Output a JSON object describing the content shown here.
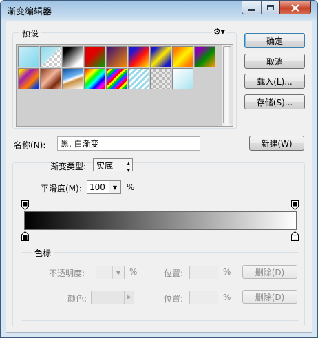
{
  "window": {
    "title": "渐变编辑器"
  },
  "presets": {
    "label": "预设",
    "gear_label": "⚙▾",
    "swatches": [
      {
        "name": "foreground-background",
        "bg": "linear-gradient(135deg,#c8eef8,#7fd6ec)"
      },
      {
        "name": "foreground-transparent",
        "bg": "linear-gradient(135deg,#8fd8ea 0%,#b9e8f2 50%,transparent 51%),repeating-conic-gradient(#ccc 0 25%,#fff 0 50%) 0 0/8px 8px"
      },
      {
        "name": "black-white",
        "bg": "linear-gradient(135deg,#000 20%,#fff 80%)"
      },
      {
        "name": "red-green",
        "bg": "linear-gradient(135deg,#e00000,#e00000 40%,#00a000)"
      },
      {
        "name": "violet-orange",
        "bg": "linear-gradient(135deg,#3a0e7a,#f58a00)"
      },
      {
        "name": "blue-red-yellow",
        "bg": "linear-gradient(135deg,#1e18d8 20%,#ff1010 55%,#ffe600)"
      },
      {
        "name": "blue-yellow-blue",
        "bg": "linear-gradient(135deg,#1818c8 15%,#ffe900 50%,#1818c8 85%)"
      },
      {
        "name": "orange-yellow-orange",
        "bg": "linear-gradient(135deg,#ff7a00 15%,#fff200 50%,#ff7a00 85%)"
      },
      {
        "name": "violet-green-orange",
        "bg": "linear-gradient(135deg,#8a00b0 20%,#008a00 55%,#ff9400)"
      },
      {
        "name": "yellow-violet-orange-blue",
        "bg": "linear-gradient(135deg,#ffd400 10%,#a020b0 35%,#ff7a00 65%,#1040d0 90%)"
      },
      {
        "name": "copper",
        "bg": "linear-gradient(135deg,#8b3a1a,#f2b49a 45%,#7a2c10 75%,#e8a080)"
      },
      {
        "name": "chrome",
        "bg": "linear-gradient(160deg,#0a50a0,#6ab0f0 40%,#fff 50%,#c89040 60%,#fff)"
      },
      {
        "name": "spectrum",
        "bg": "linear-gradient(135deg,#ff0000,#ff8800,#ffff00,#00ff00,#00ffff,#0000ff,#ff00ff,#ff0000)"
      },
      {
        "name": "transparent-rainbow",
        "bg": "repeating-linear-gradient(135deg,#ff0000 0 3px,#ffee00 3px 6px,#00d000 6px 9px,#0060ff 9px 12px,#c000ff 12px 15px)"
      },
      {
        "name": "transparent-stripes",
        "bg": "repeating-linear-gradient(135deg,#9ad8ec 0 3px,#ffffff 3px 6px),repeating-conic-gradient(#ccc 0 25%,#fff 0 50%) 0 0/8px 8px"
      },
      {
        "name": "checker-transparent",
        "bg": "repeating-conic-gradient(#b8b8b8 0 25%,#e8e8e8 0 50%) 0 0/8px 8px"
      },
      {
        "name": "white-cyan",
        "bg": "linear-gradient(135deg,#ffffff,#cfeff6 60%,#a8e2ef)"
      }
    ]
  },
  "buttons": {
    "ok": "确定",
    "cancel": "取消",
    "load": "载入(L)...",
    "save": "存储(S)...",
    "new": "新建(W)"
  },
  "name": {
    "label": "名称(N):",
    "value": "黑, 白渐变"
  },
  "gradient": {
    "type_label": "渐变类型:",
    "type_value": "实底",
    "smoothness_label": "平滑度(M):",
    "smoothness_value": "100",
    "smoothness_unit": "%",
    "start_color": "#000000",
    "end_color": "#ffffff"
  },
  "color_stops": {
    "label": "色标",
    "opacity_label": "不透明度:",
    "opacity_unit": "%",
    "location_label": "位置:",
    "location_unit": "%",
    "delete_label": "删除(D)",
    "color_label": "颜色:",
    "location2_label": "位置:",
    "location2_unit": "%",
    "delete2_label": "删除(D)"
  }
}
